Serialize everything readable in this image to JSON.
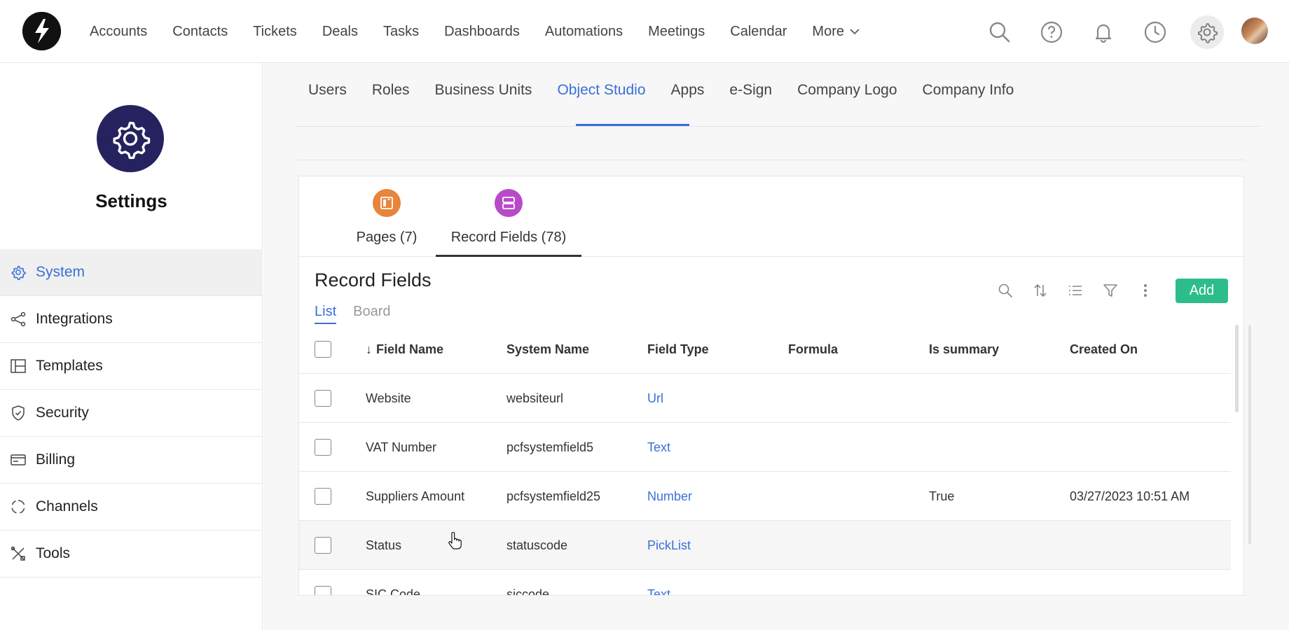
{
  "topnav": {
    "items": [
      "Accounts",
      "Contacts",
      "Tickets",
      "Deals",
      "Tasks",
      "Dashboards",
      "Automations",
      "Meetings",
      "Calendar"
    ],
    "more_label": "More",
    "icons": [
      "search-icon",
      "help-icon",
      "bell-icon",
      "clock-icon",
      "gear-icon"
    ]
  },
  "sidebar": {
    "title": "Settings",
    "items": [
      {
        "label": "System",
        "icon": "gear-icon",
        "active": true
      },
      {
        "label": "Integrations",
        "icon": "share-icon"
      },
      {
        "label": "Templates",
        "icon": "layout-icon"
      },
      {
        "label": "Security",
        "icon": "shield-icon"
      },
      {
        "label": "Billing",
        "icon": "card-icon"
      },
      {
        "label": "Channels",
        "icon": "channels-icon"
      },
      {
        "label": "Tools",
        "icon": "tools-icon"
      }
    ]
  },
  "tabs": {
    "items": [
      "Users",
      "Roles",
      "Business Units",
      "Object Studio",
      "Apps",
      "e-Sign",
      "Company Logo",
      "Company Info"
    ],
    "active": "Object Studio"
  },
  "subtabs": {
    "pages_label": "Pages (7)",
    "record_fields_label": "Record Fields (78)",
    "pages_color": "#e8843c",
    "record_fields_color": "#b84ac8"
  },
  "record_fields": {
    "title": "Record Fields",
    "view_list": "List",
    "view_board": "Board",
    "add_label": "Add",
    "columns": [
      "Field Name",
      "System Name",
      "Field Type",
      "Formula",
      "Is summary",
      "Created On"
    ],
    "rows": [
      {
        "field_name": "Website",
        "system_name": "websiteurl",
        "field_type": "Url",
        "formula": "",
        "is_summary": "",
        "created_on": ""
      },
      {
        "field_name": "VAT Number",
        "system_name": "pcfsystemfield5",
        "field_type": "Text",
        "formula": "",
        "is_summary": "",
        "created_on": ""
      },
      {
        "field_name": "Suppliers Amount",
        "system_name": "pcfsystemfield25",
        "field_type": "Number",
        "formula": "",
        "is_summary": "True",
        "created_on": "03/27/2023 10:51 AM"
      },
      {
        "field_name": "Status",
        "system_name": "statuscode",
        "field_type": "PickList",
        "formula": "",
        "is_summary": "",
        "created_on": ""
      },
      {
        "field_name": "SIC Code",
        "system_name": "siccode",
        "field_type": "Text",
        "formula": "",
        "is_summary": "",
        "created_on": ""
      }
    ]
  },
  "colors": {
    "accent": "#3a6fd8",
    "add_button": "#2dbd8a",
    "settings_circle": "#26225f"
  }
}
